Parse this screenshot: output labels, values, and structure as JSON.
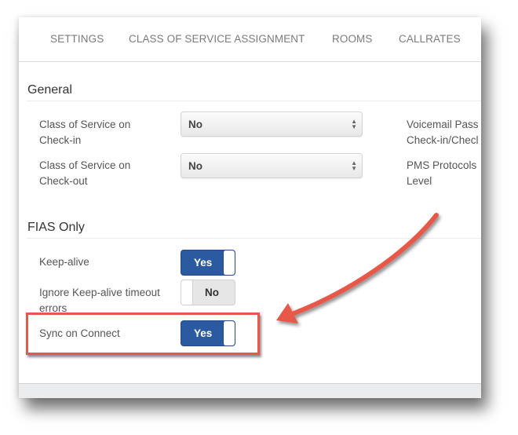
{
  "tabs": [
    {
      "label": "SETTINGS"
    },
    {
      "label": "CLASS OF SERVICE ASSIGNMENT"
    },
    {
      "label": "ROOMS"
    },
    {
      "label": "CALLRATES"
    }
  ],
  "general": {
    "title": "General",
    "fields": [
      {
        "label_line1": "Class of Service on",
        "label_line2": "Check-in",
        "value": "No"
      },
      {
        "label_line1": "Class of Service on",
        "label_line2": "Check-out",
        "value": "No"
      }
    ],
    "right_fields": [
      {
        "label_line1": "Voicemail Pass",
        "label_line2": "Check-in/Checl"
      },
      {
        "label_line1": "PMS Protocols",
        "label_line2": "Level"
      }
    ]
  },
  "fias": {
    "title": "FIAS Only",
    "toggles": [
      {
        "label_line1": "Keep-alive",
        "label_line2": "",
        "value": "Yes",
        "on": true
      },
      {
        "label_line1": "Ignore Keep-alive timeout",
        "label_line2": "errors",
        "value": "No",
        "on": false
      },
      {
        "label_line1": "Sync on Connect",
        "label_line2": "",
        "value": "Yes",
        "on": true
      }
    ]
  },
  "annotation": {
    "color": "#e8584a",
    "highlighted_field": "Sync on Connect"
  }
}
